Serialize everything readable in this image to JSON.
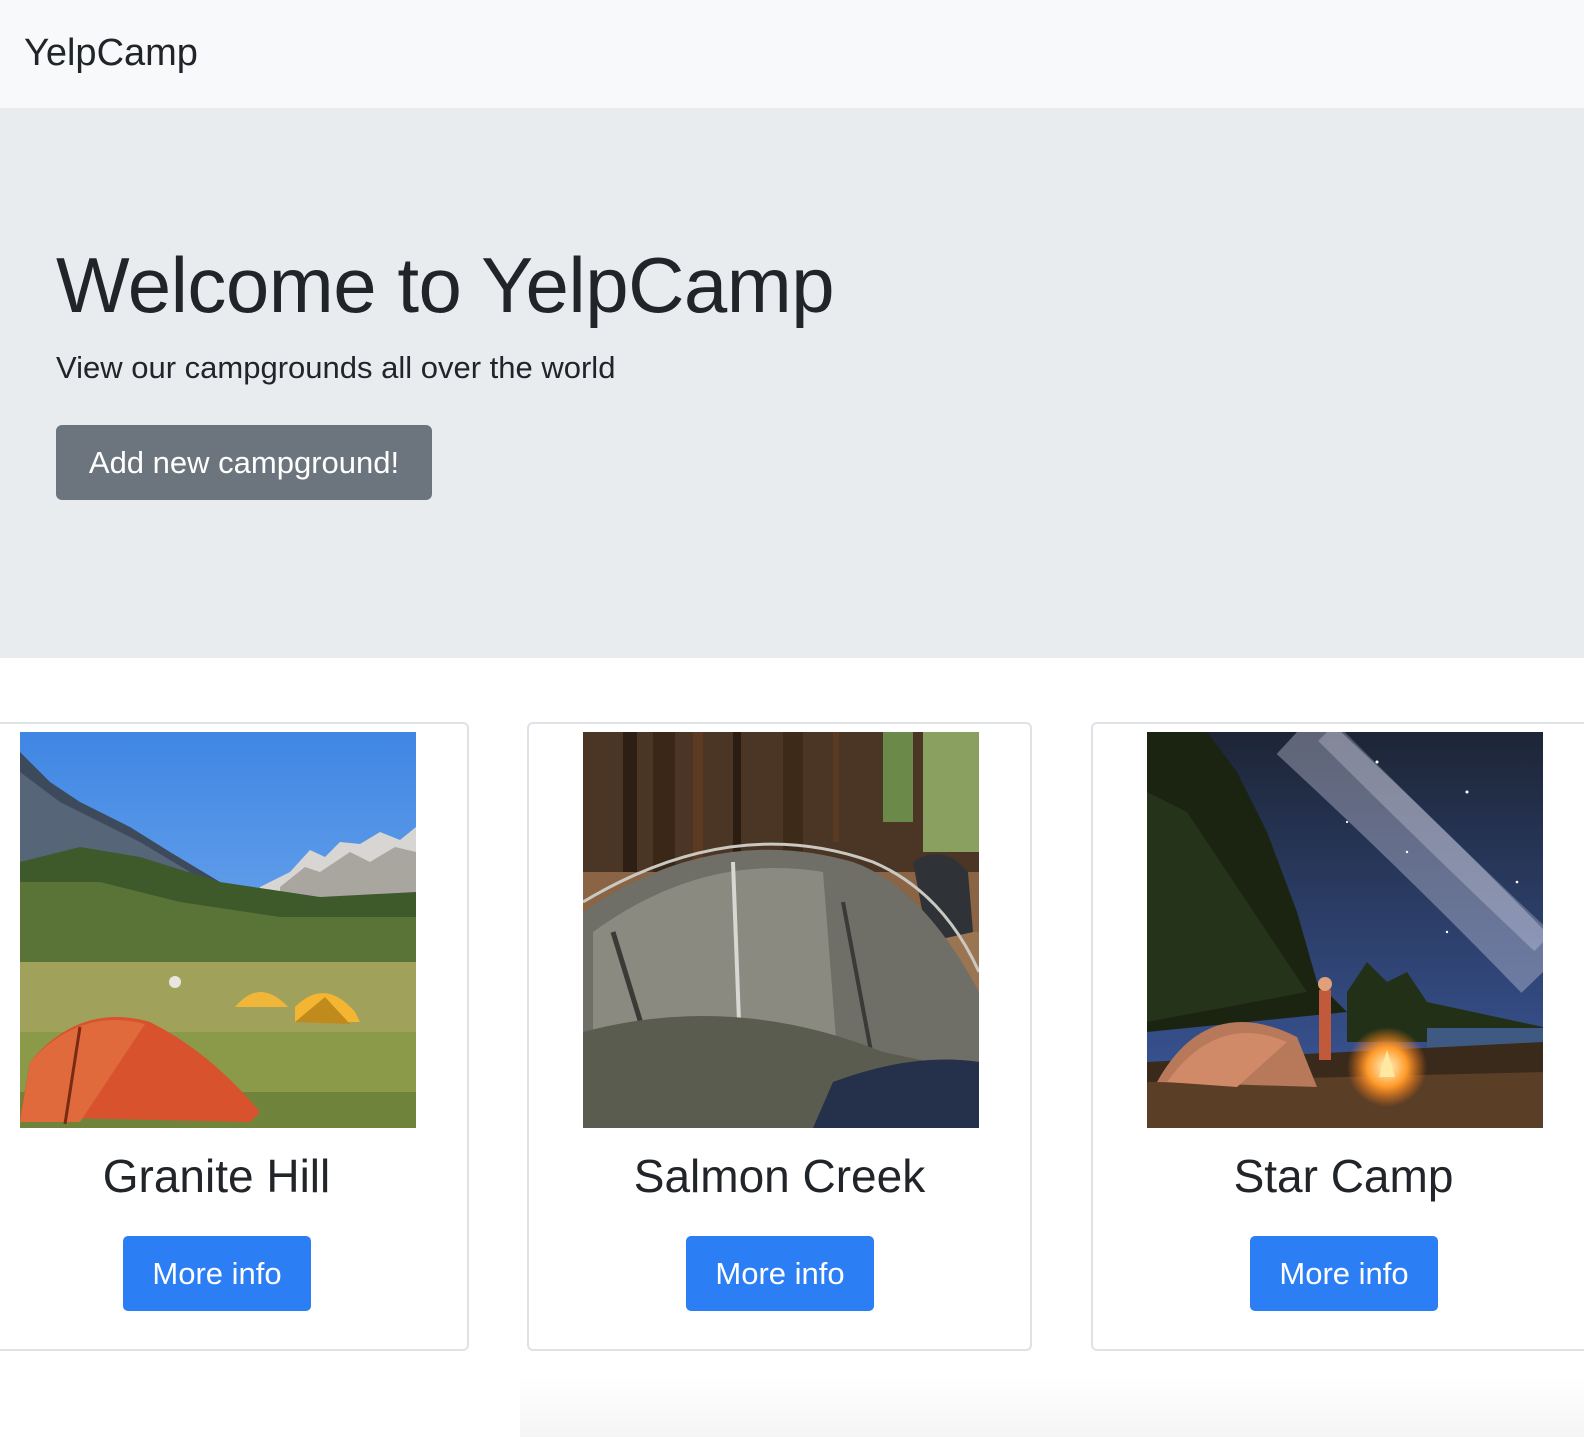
{
  "navbar": {
    "brand": "YelpCamp"
  },
  "jumbotron": {
    "title": "Welcome to YelpCamp",
    "subtitle": "View our campgrounds all over the world",
    "add_button": "Add new campground!"
  },
  "campgrounds": [
    {
      "name": "Granite Hill",
      "button": "More info",
      "image": "tents-in-mountain-meadow"
    },
    {
      "name": "Salmon Creek",
      "button": "More info",
      "image": "tent-in-forest"
    },
    {
      "name": "Star Camp",
      "button": "More info",
      "image": "tent-under-milky-way"
    }
  ],
  "colors": {
    "navbar_bg": "#f8f9fa",
    "jumbotron_bg": "#e9ecef",
    "secondary_button": "#6c757d",
    "primary_button": "#2c7ef5"
  }
}
